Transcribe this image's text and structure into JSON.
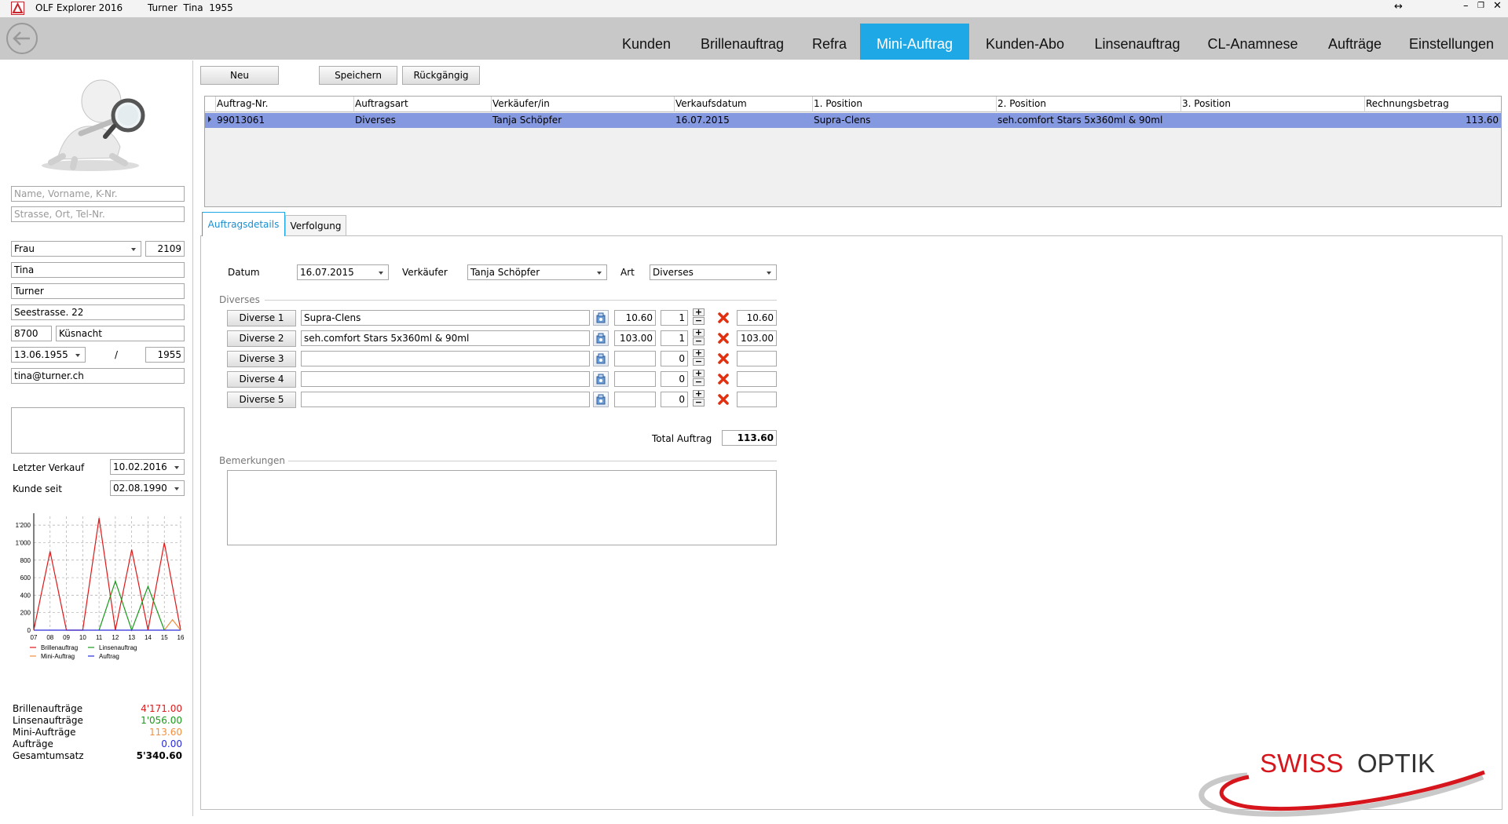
{
  "window": {
    "app_title": "OLF Explorer 2016",
    "customer_title": "Turner  Tina  1955"
  },
  "nav": {
    "tabs": [
      "Kunden",
      "Brillenauftrag",
      "Refra",
      "Mini-Auftrag",
      "Kunden-Abo",
      "Linsenauftrag",
      "CL-Anamnese",
      "Aufträge",
      "Einstellungen"
    ],
    "active": "Mini-Auftrag"
  },
  "customer": {
    "search_name_placeholder": "Name, Vorname, K-Nr.",
    "search_address_placeholder": "Strasse, Ort, Tel-Nr.",
    "salutation": "Frau",
    "number": "2109",
    "firstname": "Tina",
    "lastname": "Turner",
    "street": "Seestrasse. 22",
    "zip": "8700",
    "city": "Küsnacht",
    "birthdate": "13.06.1955",
    "slash": "/",
    "year": "1955",
    "email": "tina@turner.ch",
    "note": "",
    "last_sale_label": "Letzter Verkauf",
    "last_sale": "10.02.2016",
    "customer_since_label": "Kunde seit",
    "customer_since": "02.08.1990"
  },
  "chart_data": {
    "type": "line",
    "x": [
      "07",
      "08",
      "09",
      "10",
      "11",
      "12",
      "13",
      "14",
      "15",
      "16"
    ],
    "yticks": [
      "0",
      "200",
      "400",
      "600",
      "800",
      "1'000",
      "1'200"
    ],
    "ylim": [
      0,
      1300
    ],
    "series": [
      {
        "name": "Brillenauftrag",
        "color": "#e01818",
        "points": [
          [
            0,
            0
          ],
          [
            1,
            900
          ],
          [
            2,
            0
          ],
          [
            3,
            0
          ],
          [
            4,
            1280
          ],
          [
            5,
            0
          ],
          [
            6,
            920
          ],
          [
            7,
            0
          ],
          [
            8,
            1000
          ],
          [
            9,
            0
          ]
        ]
      },
      {
        "name": "Linsenauftrag",
        "color": "#1a9a1a",
        "points": [
          [
            4,
            0
          ],
          [
            5,
            560
          ],
          [
            6,
            0
          ],
          [
            7,
            500
          ],
          [
            8,
            0
          ]
        ]
      },
      {
        "name": "Mini-Auftrag",
        "color": "#f09040",
        "points": [
          [
            8,
            0
          ],
          [
            8.5,
            120
          ],
          [
            9,
            0
          ]
        ]
      },
      {
        "name": "Auftrag",
        "color": "#2a2adc",
        "points": [
          [
            0,
            0
          ],
          [
            9,
            0
          ]
        ]
      }
    ]
  },
  "totals": [
    {
      "label": "Brillenaufträge",
      "value": "4'171.00",
      "color": "#e01818"
    },
    {
      "label": "Linsenaufträge",
      "value": "1'056.00",
      "color": "#1a9a1a"
    },
    {
      "label": "Mini-Aufträge",
      "value": "113.60",
      "color": "#f09040"
    },
    {
      "label": "Aufträge",
      "value": "0.00",
      "color": "#2a2adc"
    },
    {
      "label": "Gesamtumsatz",
      "value": "5'340.60",
      "color": "#000000"
    }
  ],
  "toolbar": {
    "new": "Neu",
    "save": "Speichern",
    "undo": "Rückgängig"
  },
  "grid": {
    "columns": [
      "Auftrag-Nr.",
      "Auftragsart",
      "Verkäufer/in",
      "Verkaufsdatum",
      "1. Position",
      "2. Position",
      "3. Position",
      "Rechnungsbetrag"
    ],
    "rows": [
      [
        "99013061",
        "Diverses",
        "Tanja Schöpfer",
        "16.07.2015",
        "Supra-Clens",
        "seh.comfort Stars 5x360ml & 90ml",
        "",
        "113.60"
      ]
    ]
  },
  "detail_tabs": [
    "Auftragsdetails",
    "Verfolgung"
  ],
  "details": {
    "date_label": "Datum",
    "date": "16.07.2015",
    "seller_label": "Verkäufer",
    "seller": "Tanja Schöpfer",
    "type_label": "Art",
    "type": "Diverses",
    "section_label": "Diverses",
    "items": [
      {
        "button": "Diverse 1",
        "description": "Supra-Clens",
        "price": "10.60",
        "qty": "1",
        "total": "10.60"
      },
      {
        "button": "Diverse 2",
        "description": "seh.comfort Stars 5x360ml & 90ml",
        "price": "103.00",
        "qty": "1",
        "total": "103.00"
      },
      {
        "button": "Diverse 3",
        "description": "",
        "price": "",
        "qty": "0",
        "total": ""
      },
      {
        "button": "Diverse 4",
        "description": "",
        "price": "",
        "qty": "0",
        "total": ""
      },
      {
        "button": "Diverse 5",
        "description": "",
        "price": "",
        "qty": "0",
        "total": ""
      }
    ],
    "total_label": "Total Auftrag",
    "total": "113.60",
    "remarks_label": "Bemerkungen",
    "remarks": ""
  },
  "logo": {
    "part1": "SWISS",
    "part2": "OPTIK"
  }
}
